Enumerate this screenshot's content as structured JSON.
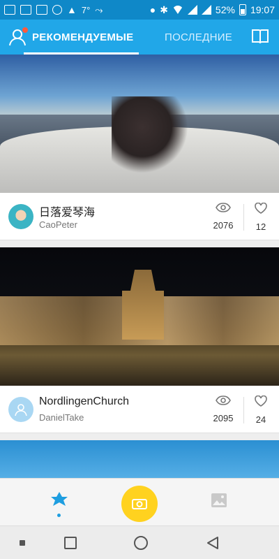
{
  "status_bar": {
    "temperature": "7°",
    "battery": "52%",
    "time": "19:07"
  },
  "header": {
    "tabs": [
      {
        "label": "РЕКОМЕНДУЕМЫЕ",
        "active": true
      },
      {
        "label": "ПОСЛЕДНИЕ",
        "active": false
      }
    ]
  },
  "feed": {
    "items": [
      {
        "title": "日落爱琴海",
        "author": "CaoPeter",
        "views": "2076",
        "likes": "12"
      },
      {
        "title": "NordlingenChurch",
        "author": "DanielTake",
        "views": "2095",
        "likes": "24"
      }
    ]
  },
  "colors": {
    "accent": "#21a7e8",
    "camera": "#ffd21f",
    "notification": "#ff5a3c"
  },
  "icons": {
    "header_left": "user-icon",
    "header_right": "book-icon",
    "nav_featured": "featured-star-icon",
    "nav_camera": "camera-icon",
    "nav_gallery": "gallery-icon"
  }
}
